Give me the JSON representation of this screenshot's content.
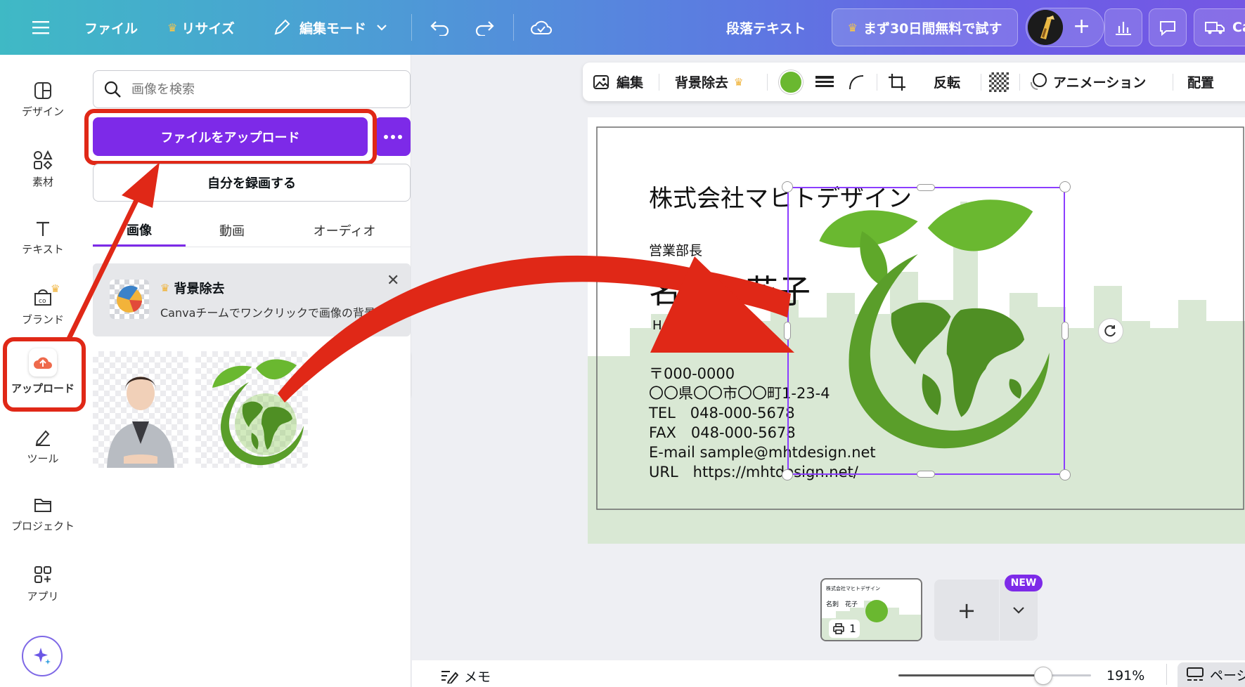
{
  "topbar": {
    "file": "ファイル",
    "resize": "リサイズ",
    "edit_mode": "編集モード",
    "paragraph_text": "段落テキスト",
    "trial": "まず30日間無料で試す",
    "canva_truncated": "Ca"
  },
  "rail": {
    "design": "デザイン",
    "elements": "素材",
    "text": "テキスト",
    "brand": "ブランド",
    "upload": "アップロード",
    "tools": "ツール",
    "projects": "プロジェクト",
    "apps": "アプリ"
  },
  "panel": {
    "search_placeholder": "画像を検索",
    "upload_button": "ファイルをアップロード",
    "record_button": "自分を録画する",
    "tabs": [
      "画像",
      "動画",
      "オーディオ"
    ],
    "promo_title": "背景除去",
    "promo_desc": "Canvaチームでワンクリックで画像の背景..."
  },
  "toolbar": {
    "edit": "編集",
    "bg_remove": "背景除去",
    "flip": "反転",
    "animation": "アニメーション",
    "position": "配置"
  },
  "card": {
    "company": "株式会社マヒトデザイン",
    "title": "営業部長",
    "name": "名刺　花子",
    "romaji": "Hanako Meishi",
    "postal": "〒000-0000",
    "address": "〇〇県〇〇市〇〇町1-23-4",
    "tel": "TEL　048-000-5678",
    "fax": "FAX　048-000-5678",
    "email": "E-mail sample@mhtdesign.net",
    "url": "URL　https://mhtdesign.net/"
  },
  "pages": {
    "thumb_company": "株式会社マヒトデザイン",
    "thumb_name": "名刺　花子",
    "page_number": "1",
    "new_badge": "NEW"
  },
  "footer": {
    "memo": "メモ",
    "zoom": "191%",
    "zoom_fraction": 0.75,
    "pages_label": "ページ"
  },
  "colors": {
    "accent": "#7d2ae8",
    "annotation_red": "#e02817",
    "leaf_green": "#6ab830",
    "city_green": "#d9e8d4"
  }
}
